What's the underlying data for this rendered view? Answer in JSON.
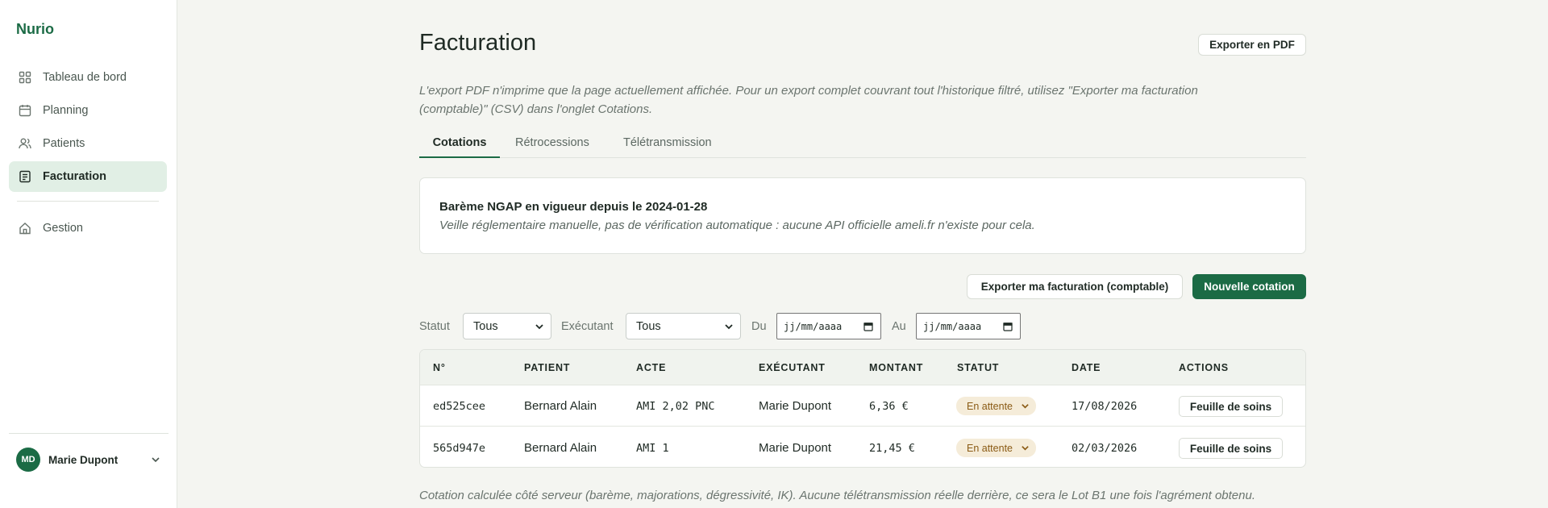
{
  "app": {
    "brand": "Nurio"
  },
  "sidebar": {
    "items": [
      {
        "label": "Tableau de bord",
        "icon": "dashboard-icon"
      },
      {
        "label": "Planning",
        "icon": "calendar-icon"
      },
      {
        "label": "Patients",
        "icon": "users-icon"
      },
      {
        "label": "Facturation",
        "icon": "receipt-icon",
        "active": true
      }
    ],
    "secondary": [
      {
        "label": "Gestion",
        "icon": "home-icon"
      }
    ],
    "user": {
      "initials": "MD",
      "name": "Marie Dupont"
    }
  },
  "page": {
    "title": "Facturation",
    "export_pdf_label": "Exporter en PDF",
    "info_note": "L'export PDF n'imprime que la page actuellement affichée. Pour un export complet couvrant tout l'historique filtré, utilisez \"Exporter ma facturation (comptable)\" (CSV) dans l'onglet Cotations.",
    "tabs": [
      "Cotations",
      "Rétrocessions",
      "Télétransmission"
    ],
    "active_tab": "Cotations"
  },
  "notice": {
    "title": "Barème NGAP en vigueur depuis le 2024-01-28",
    "subtitle": "Veille réglementaire manuelle, pas de vérification automatique : aucune API officielle ameli.fr n'existe pour cela."
  },
  "actions": {
    "export_compta_label": "Exporter ma facturation (comptable)",
    "new_label": "Nouvelle cotation"
  },
  "filters": {
    "statut_label": "Statut",
    "statut_value": "Tous",
    "executant_label": "Exécutant",
    "executant_value": "Tous",
    "du_label": "Du",
    "du_placeholder": "jj/mm/aaaa",
    "au_label": "Au",
    "au_placeholder": "jj/mm/aaaa"
  },
  "table": {
    "headers": [
      "N°",
      "PATIENT",
      "ACTE",
      "EXÉCUTANT",
      "MONTANT",
      "STATUT",
      "DATE",
      "ACTIONS"
    ],
    "rows": [
      {
        "num": "ed525cee",
        "patient": "Bernard Alain",
        "acte": "AMI 2,02 PNC",
        "executant": "Marie Dupont",
        "montant": "6,36 €",
        "statut": "En attente",
        "date": "17/08/2026",
        "action": "Feuille de soins"
      },
      {
        "num": "565d947e",
        "patient": "Bernard Alain",
        "acte": "AMI 1",
        "executant": "Marie Dupont",
        "montant": "21,45 €",
        "statut": "En attente",
        "date": "02/03/2026",
        "action": "Feuille de soins"
      }
    ]
  },
  "footnote": "Cotation calculée côté serveur (barème, majorations, dégressivité, IK). Aucune télétransmission réelle derrière, ce sera le Lot B1 une fois l'agrément obtenu.",
  "colors": {
    "brand": "#1b6b45",
    "badge_bg": "#f5ecd9",
    "badge_text": "#8a5a14"
  }
}
